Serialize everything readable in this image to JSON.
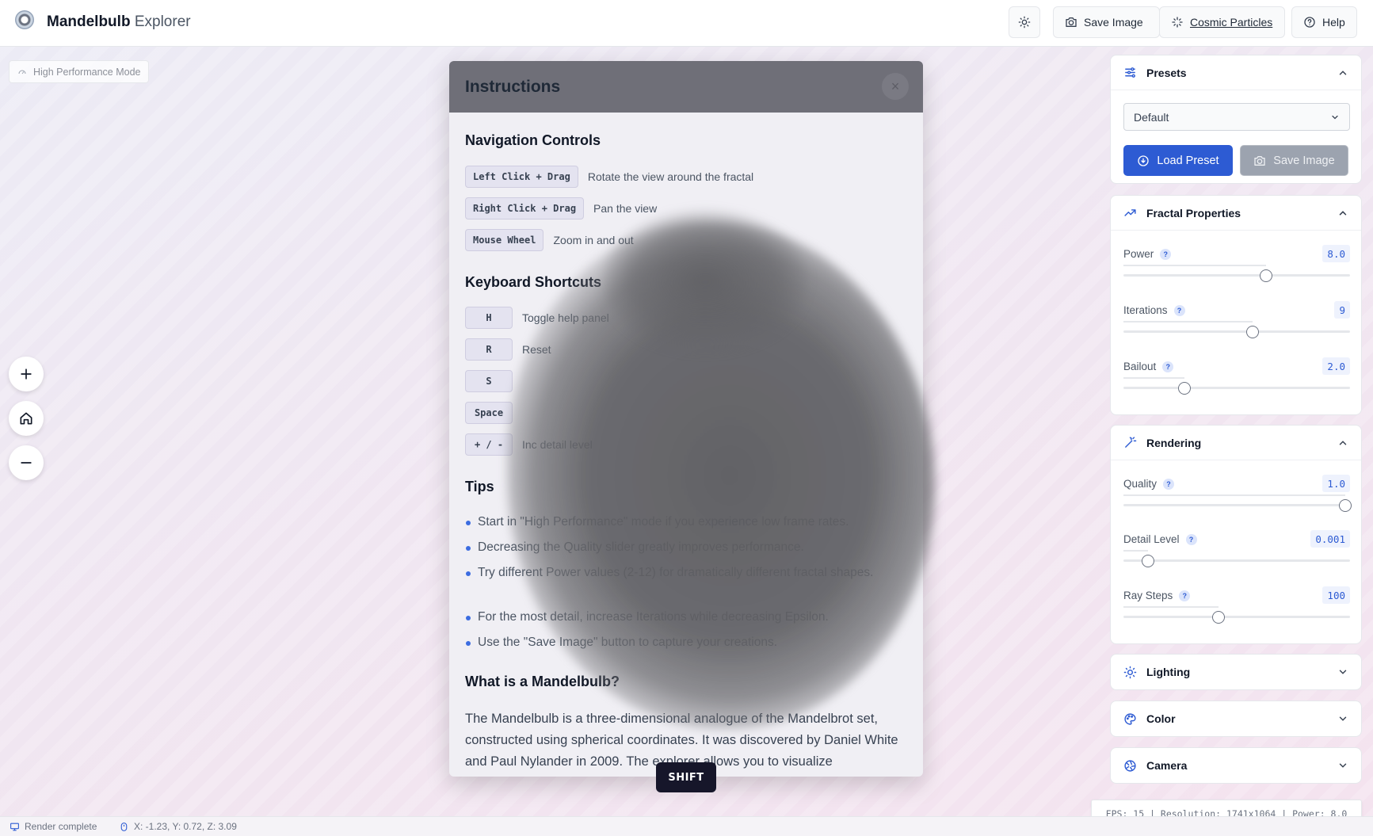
{
  "header": {
    "title_bold": "Mandelbulb",
    "title_rest": "Explorer",
    "save_image_label": "Save Image",
    "cosmic_particles_label": "Cosmic Particles",
    "help_label": "Help"
  },
  "canvas": {
    "performance_badge": "High Performance Mode"
  },
  "instructions": {
    "title": "Instructions",
    "close_glyph": "×",
    "navigation_title": "Navigation Controls",
    "navigation": [
      {
        "key": "Left Click + Drag",
        "desc": "Rotate the view around the fractal"
      },
      {
        "key": "Right Click + Drag",
        "desc": "Pan the view"
      },
      {
        "key": "Mouse Wheel",
        "desc": "Zoom in and out"
      }
    ],
    "keyboard_title": "Keyboard Shortcuts",
    "shortcuts": [
      {
        "key": "H",
        "desc": "Toggle help panel"
      },
      {
        "key": "R",
        "desc": "Reset"
      },
      {
        "key": "S",
        "desc": ""
      },
      {
        "key": "Space",
        "desc": ""
      },
      {
        "key": "+ / -",
        "desc": "Inc detail level"
      }
    ],
    "tips_title": "Tips",
    "tips": [
      "Start in \"High Performance\" mode if you experience low frame rates.",
      "Decreasing the Quality slider greatly improves performance.",
      "Try different Power values (2-12) for dramatically different fractal shapes.",
      "For the most detail, increase Iterations while decreasing Epsilon.",
      "Use the \"Save Image\" button to capture your creations."
    ],
    "about_title": "What is a Mandelbulb?",
    "about_text": "The Mandelbulb is a three-dimensional analogue of the Mandelbrot set, constructed using spherical coordinates. It was discovered by Daniel White and Paul Nylander in 2009. The explorer allows you to visualize"
  },
  "key_overlay": "SHIFT",
  "presets": {
    "title": "Presets",
    "selected": "Default",
    "load_label": "Load Preset",
    "save_label": "Save Image"
  },
  "fractal": {
    "title": "Fractal Properties",
    "controls": [
      {
        "label": "Power",
        "value": "8.0",
        "fraction": 0.63
      },
      {
        "label": "Iterations",
        "value": "9",
        "fraction": 0.57
      },
      {
        "label": "Bailout",
        "value": "2.0",
        "fraction": 0.27
      }
    ]
  },
  "rendering": {
    "title": "Rendering",
    "controls": [
      {
        "label": "Quality",
        "value": "1.0",
        "fraction": 0.98
      },
      {
        "label": "Detail Level",
        "value": "0.001",
        "fraction": 0.11
      },
      {
        "label": "Ray Steps",
        "value": "100",
        "fraction": 0.42
      }
    ]
  },
  "collapsed_sections": {
    "lighting": "Lighting",
    "color": "Color",
    "camera": "Camera"
  },
  "status": {
    "render": "Render complete",
    "coords": "X: -1.23, Y: 0.72, Z: 3.09",
    "fps_info": "FPS: 15 | Resolution: 1741x1064 | Power: 8.0"
  },
  "colors": {
    "accent": "#2d5bd3",
    "modal_header": "#6f6f78"
  }
}
